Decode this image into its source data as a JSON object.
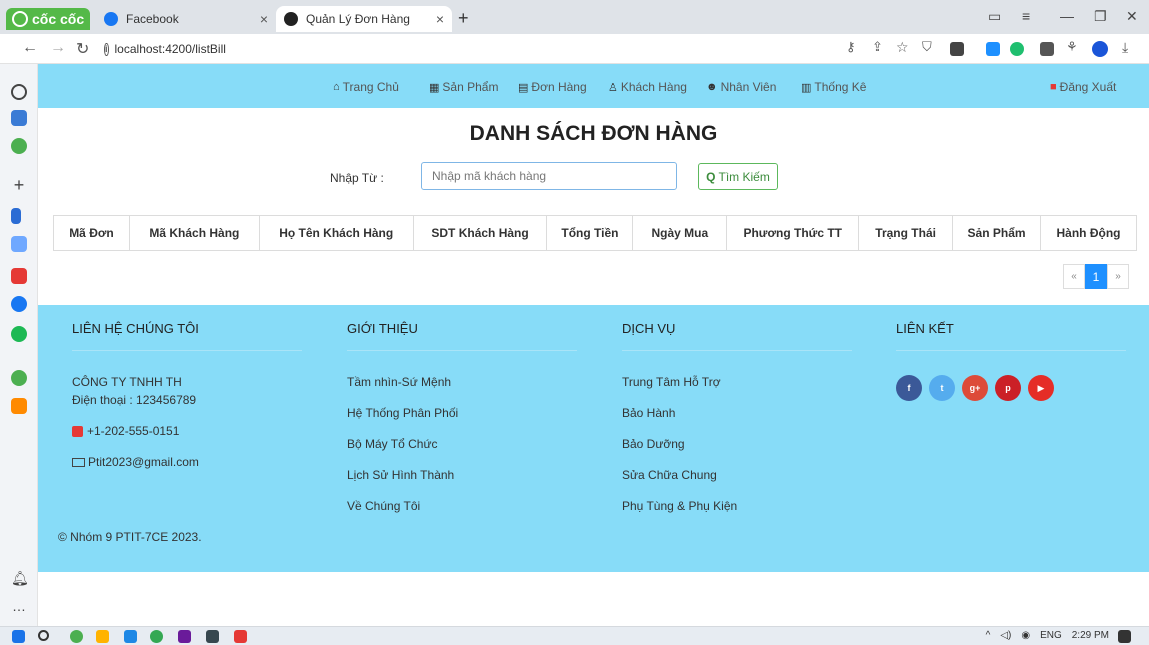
{
  "browser": {
    "brand": "cốc cốc",
    "tabs": [
      {
        "title": "Facebook",
        "close": "×"
      },
      {
        "title": "Quản Lý Đơn Hàng",
        "close": "×"
      }
    ],
    "new_tab": "+",
    "url": "localhost:4200/listBill"
  },
  "nav": {
    "items": [
      {
        "icon": "home-icon",
        "label": "Trang Chủ"
      },
      {
        "icon": "grid-icon",
        "label": "Sản Phẩm"
      },
      {
        "icon": "document-icon",
        "label": "Đơn Hàng"
      },
      {
        "icon": "person-icon",
        "label": "Khách Hàng"
      },
      {
        "icon": "people-icon",
        "label": "Nhân Viên"
      },
      {
        "icon": "chart-icon",
        "label": "Thống Kê"
      }
    ],
    "logout": "Đăng Xuất"
  },
  "page": {
    "title": "DANH SÁCH ĐƠN HÀNG",
    "search_label": "Nhập Từ :",
    "search_placeholder": "Nhập mã khách hàng",
    "search_button": "Tìm Kiếm"
  },
  "table": {
    "headers": [
      "Mã Đơn",
      "Mã Khách Hàng",
      "Họ Tên Khách Hàng",
      "SDT Khách Hàng",
      "Tổng Tiền",
      "Ngày Mua",
      "Phương Thức TT",
      "Trạng Thái",
      "Sản Phẩm",
      "Hành Động"
    ],
    "rows": []
  },
  "pagination": {
    "prev": "«",
    "current": "1",
    "next": "»"
  },
  "footer": {
    "contact": {
      "heading": "LIÊN HỆ CHÚNG TÔI",
      "company": "CÔNG TY TNHH TH",
      "phone_line": "Điện thoại : 123456789",
      "mobile": "+1-202-555-0151",
      "email": "Ptit2023@gmail.com"
    },
    "about": {
      "heading": "GIỚI THIỆU",
      "links": [
        "Tầm nhìn-Sứ Mệnh",
        "Hệ Thống Phân Phối",
        "Bộ Máy Tổ Chức",
        "Lịch Sử Hình Thành",
        "Về Chúng Tôi"
      ]
    },
    "services": {
      "heading": "DỊCH VỤ",
      "links": [
        "Trung Tâm Hỗ Trợ",
        "Bảo Hành",
        "Bảo Dưỡng",
        "Sửa Chữa Chung",
        "Phụ Tùng & Phụ Kiện"
      ]
    },
    "links": {
      "heading": "LIÊN KẾT",
      "social": [
        {
          "name": "facebook-icon",
          "glyph": "f",
          "color": "#3b5998"
        },
        {
          "name": "twitter-icon",
          "glyph": "t",
          "color": "#55acee"
        },
        {
          "name": "google-plus-icon",
          "glyph": "g+",
          "color": "#dd4b39"
        },
        {
          "name": "pinterest-icon",
          "glyph": "p",
          "color": "#cb2027"
        },
        {
          "name": "youtube-icon",
          "glyph": "▶",
          "color": "#e52d27"
        }
      ]
    },
    "copyright": "© Nhóm 9 PTIT-7CE 2023."
  },
  "taskbar": {
    "language": "ENG",
    "time": "2:29 PM"
  },
  "colors": {
    "nav_bg": "#87dcf8",
    "footer_bg": "#87dcf8",
    "accent": "#1e90ff",
    "search_button": "#5cb85c",
    "logout_icon": "#e53935"
  }
}
